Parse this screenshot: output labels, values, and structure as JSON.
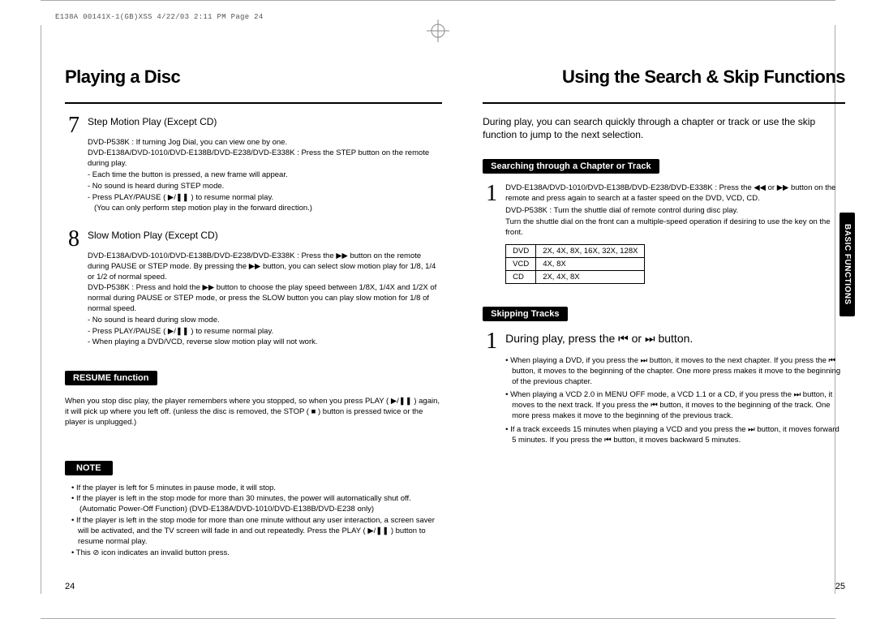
{
  "meta": {
    "header": "E138A 00141X-1(GB)XSS  4/22/03 2:11 PM  Page 24",
    "side_tab": "BASIC FUNCTIONS",
    "page_left": "24",
    "page_right": "25"
  },
  "left": {
    "title": "Playing a Disc",
    "step7": {
      "num": "7",
      "title": "Step Motion Play (Except CD)",
      "l1": "DVD-P538K : If turning Jog Dial, you can view one by one.",
      "l2": "DVD-E138A/DVD-1010/DVD-E138B/DVD-E238/DVD-E338K : Press the STEP button on the remote during play.",
      "l3": "- Each time the button is pressed, a new frame will appear.",
      "l4": "- No sound is heard during STEP mode.",
      "l5": "- Press PLAY/PAUSE ( ▶/❚❚ ) to resume normal play.",
      "l6": "(You can only perform step motion play in the forward direction.)"
    },
    "step8": {
      "num": "8",
      "title": "Slow Motion Play (Except CD)",
      "l1": "DVD-E138A/DVD-1010/DVD-E138B/DVD-E238/DVD-E338K : Press the ▶▶ button on the remote during PAUSE or STEP mode. By pressing the ▶▶ button, you can select slow motion play for 1/8, 1/4 or 1/2 of normal speed.",
      "l2": "DVD-P538K : Press and hold the ▶▶ button to choose the play speed between 1/8X, 1/4X and 1/2X of normal during PAUSE or STEP mode, or press the SLOW button you can play slow motion for 1/8 of normal speed.",
      "l3": "- No sound is heard during slow mode.",
      "l4": "- Press PLAY/PAUSE ( ▶/❚❚ ) to resume normal play.",
      "l5": "- When playing a DVD/VCD, reverse slow motion play will not work."
    },
    "resume": {
      "label": "RESUME function",
      "text": "When you stop disc play, the player remembers where you stopped, so when you press PLAY ( ▶/❚❚ ) again, it will pick up where you left off. (unless the disc is removed, the STOP ( ■ ) button is pressed twice or the player is unplugged.)"
    },
    "note": {
      "label": "NOTE",
      "b1": "If the player is left for 5 minutes in pause mode, it will stop.",
      "b2": "If the player is left in the stop mode for more than 30 minutes, the power will automatically shut off.",
      "b2b": "(Automatic Power-Off Function) (DVD-E138A/DVD-1010/DVD-E138B/DVD-E238 only)",
      "b3": "If the player is left in the stop mode for more than one minute without any user interaction, a screen saver will be activated, and the TV screen will fade in and out repeatedly. Press the PLAY ( ▶/❚❚ ) button to resume normal play.",
      "b4": "This ⊘ icon indicates an invalid button press."
    }
  },
  "right": {
    "title": "Using the Search & Skip Functions",
    "intro": "During play, you can search quickly through a chapter or track or use the skip function to jump to the next selection.",
    "search": {
      "label": "Searching through a Chapter or Track",
      "num": "1",
      "l1": "DVD-E138A/DVD-1010/DVD-E138B/DVD-E238/DVD-E338K : Press the ◀◀ or ▶▶ button on the remote and press again to search at a faster speed on the DVD, VCD, CD.",
      "l2": "DVD-P538K : Turn the shuttle dial of remote control during disc play.",
      "l3": "Turn the shuttle dial on the front can a multiple-speed operation if desiring to use the key on the front."
    },
    "speeds": {
      "dvd_label": "DVD",
      "dvd": "2X, 4X, 8X, 16X, 32X, 128X",
      "vcd_label": "VCD",
      "vcd": "4X, 8X",
      "cd_label": "CD",
      "cd": "2X, 4X, 8X"
    },
    "skip": {
      "label": "Skipping Tracks",
      "num": "1",
      "line": "During play, press the ⏮ or ⏭ button.",
      "b1": "When playing a DVD, if you press the ⏭ button, it moves to the next chapter. If you press the ⏮ button, it moves to the beginning of the chapter. One more press makes it move to the beginning of the previous chapter.",
      "b2": "When playing a VCD 2.0 in MENU OFF mode, a VCD 1.1 or a CD, if you press the ⏭ button, it moves to the next track. If you press the ⏮ button, it moves to the beginning of the track. One more press makes it move to the beginning of the previous track.",
      "b3": "If a track exceeds 15 minutes when playing a VCD and you press the ⏭ button, it moves forward 5 minutes. If you press the ⏮ button, it moves backward 5 minutes."
    }
  }
}
